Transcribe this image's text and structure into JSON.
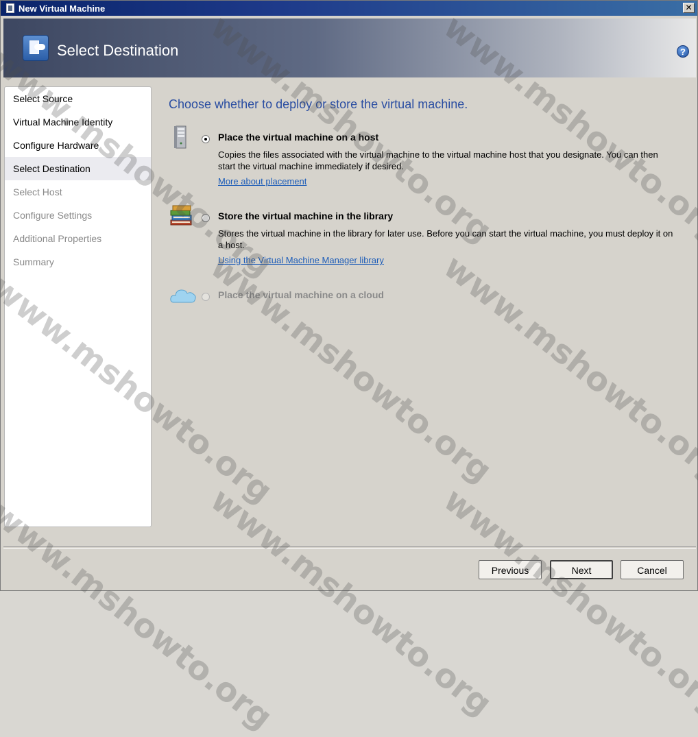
{
  "window": {
    "title": "New Virtual Machine",
    "close_glyph": "✕"
  },
  "header": {
    "title": "Select Destination",
    "help_glyph": "?"
  },
  "steps": [
    {
      "label": "Select Source",
      "state": "done"
    },
    {
      "label": "Virtual Machine Identity",
      "state": "done"
    },
    {
      "label": "Configure Hardware",
      "state": "done"
    },
    {
      "label": "Select Destination",
      "state": "current"
    },
    {
      "label": "Select Host",
      "state": "disabled"
    },
    {
      "label": "Configure Settings",
      "state": "disabled"
    },
    {
      "label": "Additional Properties",
      "state": "disabled"
    },
    {
      "label": "Summary",
      "state": "disabled"
    }
  ],
  "main": {
    "question": "Choose whether to deploy or store the virtual machine.",
    "options": [
      {
        "label": "Place the virtual machine on a host",
        "description": "Copies the files associated with the virtual machine to the virtual machine host that you designate.  You can then start the virtual machine immediately if desired.",
        "link": "More about placement",
        "selected": true,
        "enabled": true,
        "icon": "server-icon"
      },
      {
        "label": "Store the virtual machine in the library",
        "description": "Stores the virtual machine in the library for later use. Before you can start the virtual machine, you must deploy it on a host.",
        "link": "Using the Virtual Machine Manager library",
        "selected": false,
        "enabled": true,
        "icon": "library-books-icon"
      },
      {
        "label": "Place the virtual machine on a cloud",
        "selected": false,
        "enabled": false,
        "icon": "cloud-icon"
      }
    ]
  },
  "buttons": {
    "previous": "Previous",
    "next": "Next",
    "cancel": "Cancel"
  },
  "watermark": {
    "text": "www.mshowto.org"
  },
  "colors": {
    "question_text": "#2b4ea2",
    "link": "#1c5cb8",
    "disabled_text": "#8a8a8a"
  }
}
